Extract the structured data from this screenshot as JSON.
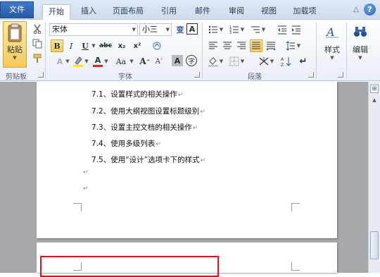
{
  "tabs": [
    "文件",
    "开始",
    "插入",
    "页面布局",
    "引用",
    "邮件",
    "审阅",
    "视图",
    "加载项"
  ],
  "help_glyph": "?",
  "collapse_glyph": "△",
  "clipboard": {
    "paste_label": "粘贴",
    "group_label": "剪贴板"
  },
  "font": {
    "name": "宋体",
    "size": "小三",
    "group_label": "字体",
    "clear_glyph": "变",
    "border_glyph": "A",
    "bold": "B",
    "italic": "I",
    "underline": "U",
    "strike": "abc",
    "subscript": "x₂",
    "superscript": "x²",
    "grow": "A",
    "shrink": "A",
    "case": "Aa",
    "color_a": "A",
    "charshade": "A",
    "enclose": "字"
  },
  "paragraph": {
    "group_label": "段落"
  },
  "styles": {
    "label": "样式"
  },
  "editing": {
    "label": "编辑"
  },
  "colors": {
    "accent": "#2b5797",
    "highlight": "#f7c95a",
    "red_box": "#d0191f",
    "font_red": "#e0241b",
    "highlighter_yellow": "#ffe900"
  },
  "document": {
    "lines": [
      "7.1、设置样式的相关操作",
      "7.2、使用大纲视图设置标题级别",
      "7.3、设置主控文档的相关操作",
      "7.4、使用多级列表",
      "7.5、使用“设计”选项卡下的样式"
    ],
    "para_mark": "↵"
  }
}
